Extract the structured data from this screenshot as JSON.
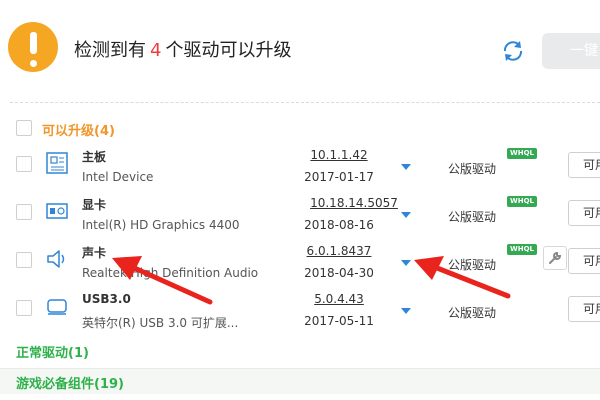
{
  "header": {
    "title_prefix": "检测到有",
    "count": "4",
    "title_suffix": "个驱动可以升级",
    "one_click_label": "一键",
    "warning_icon": "exclamation-icon",
    "refresh_icon": "refresh-icon"
  },
  "groups": {
    "upgradable": "可以升级(4)",
    "normal": "正常驱动(1)",
    "game": "游戏必备组件(19)"
  },
  "drivers": [
    {
      "name": "主板",
      "desc": "Intel Device",
      "version": "10.1.1.42",
      "date": "2017-01-17",
      "type": "公版驱动",
      "badge": "WHQL",
      "action": "可用",
      "icon": "motherboard-icon"
    },
    {
      "name": "显卡",
      "desc": "Intel(R) HD Graphics 4400",
      "version": "10.18.14.5057",
      "date": "2018-08-16",
      "type": "公版驱动",
      "badge": "WHQL",
      "action": "可用",
      "icon": "graphics-card-icon"
    },
    {
      "name": "声卡",
      "desc": "Realtek High Definition Audio",
      "version": "6.0.1.8437",
      "date": "2018-04-30",
      "type": "公版驱动",
      "badge": "WHQL",
      "action": "可用",
      "icon": "speaker-icon"
    },
    {
      "name": "USB3.0",
      "desc": "英特尔(R) USB 3.0 可扩展...",
      "version": "5.0.4.43",
      "date": "2017-05-11",
      "type": "公版驱动",
      "badge": "",
      "action": "可用",
      "icon": "usb-drive-icon"
    }
  ],
  "colors": {
    "accent_orange": "#f0962b",
    "accent_green": "#2fb14a",
    "link_blue": "#2f86d6",
    "warning": "#f5a623",
    "annotation_red": "#e8241c"
  }
}
